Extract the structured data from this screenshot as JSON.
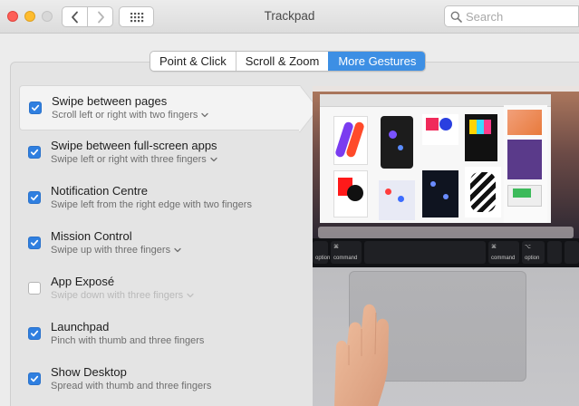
{
  "window": {
    "title": "Trackpad"
  },
  "search": {
    "placeholder": "Search",
    "value": ""
  },
  "tabs": [
    {
      "label": "Point & Click",
      "active": false
    },
    {
      "label": "Scroll & Zoom",
      "active": false
    },
    {
      "label": "More Gestures",
      "active": true
    }
  ],
  "gestures": [
    {
      "title": "Swipe between pages",
      "subtitle": "Scroll left or right with two fingers",
      "checked": true,
      "has_menu": true,
      "selected": true
    },
    {
      "title": "Swipe between full-screen apps",
      "subtitle": "Swipe left or right with three fingers",
      "checked": true,
      "has_menu": true
    },
    {
      "title": "Notification Centre",
      "subtitle": "Swipe left from the right edge with two fingers",
      "checked": true,
      "has_menu": false
    },
    {
      "title": "Mission Control",
      "subtitle": "Swipe up with three fingers",
      "checked": true,
      "has_menu": true
    },
    {
      "title": "App Exposé",
      "subtitle": "Swipe down with three fingers",
      "checked": false,
      "has_menu": true
    },
    {
      "title": "Launchpad",
      "subtitle": "Pinch with thumb and three fingers",
      "checked": true,
      "has_menu": false
    },
    {
      "title": "Show Desktop",
      "subtitle": "Spread with thumb and three fingers",
      "checked": true,
      "has_menu": false
    }
  ],
  "preview": {
    "keys": {
      "option_left": "option",
      "command_left": "command",
      "command_right": "command",
      "option_right": "option",
      "command_symbol": "⌘",
      "option_symbol": "⌥"
    }
  },
  "colors": {
    "accent": "#3d8fe4",
    "checkbox": "#2f7fe0",
    "close": "#fe5f57",
    "minimize": "#febc2e"
  },
  "icons": [
    "back-chevron-icon",
    "forward-chevron-icon",
    "grid-icon",
    "search-icon",
    "checkmark-icon",
    "chevron-down-icon"
  ]
}
